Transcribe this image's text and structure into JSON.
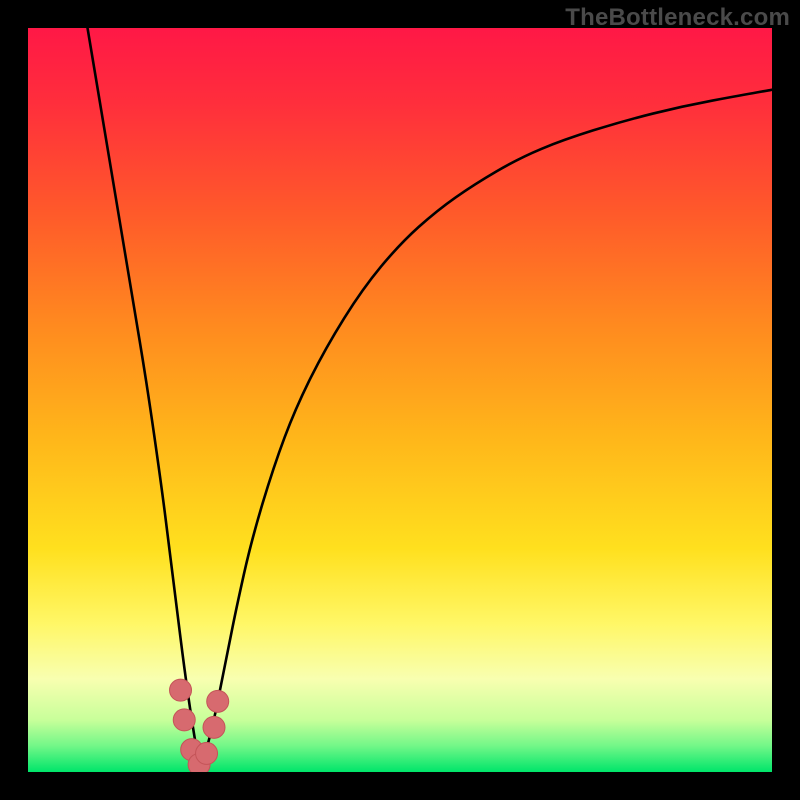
{
  "watermark": "TheBottleneck.com",
  "colors": {
    "frame": "#000000",
    "gradient_stops": [
      {
        "offset": 0.0,
        "color": "#ff1846"
      },
      {
        "offset": 0.1,
        "color": "#ff2e3c"
      },
      {
        "offset": 0.25,
        "color": "#ff5a2a"
      },
      {
        "offset": 0.4,
        "color": "#ff8a1f"
      },
      {
        "offset": 0.55,
        "color": "#ffb61a"
      },
      {
        "offset": 0.7,
        "color": "#ffe01e"
      },
      {
        "offset": 0.8,
        "color": "#fff766"
      },
      {
        "offset": 0.875,
        "color": "#f8ffb0"
      },
      {
        "offset": 0.93,
        "color": "#c8ff9a"
      },
      {
        "offset": 0.965,
        "color": "#72f788"
      },
      {
        "offset": 1.0,
        "color": "#00e56a"
      }
    ],
    "curve": "#000000",
    "marker_fill": "#d76a6f",
    "marker_stroke": "#c45458"
  },
  "chart_data": {
    "type": "line",
    "title": "",
    "xlabel": "",
    "ylabel": "",
    "xlim": [
      0,
      100
    ],
    "ylim": [
      0,
      100
    ],
    "x_min_at": 23,
    "series": [
      {
        "name": "bottleneck-curve",
        "x": [
          8,
          10,
          12,
          14,
          16,
          18,
          19,
          20,
          21,
          22,
          23,
          24,
          25,
          26,
          27,
          28,
          30,
          33,
          36,
          40,
          45,
          50,
          55,
          60,
          66,
          72,
          80,
          88,
          96,
          100
        ],
        "values": [
          100,
          88,
          76,
          64,
          52,
          38,
          30,
          22,
          14,
          7,
          1,
          3,
          7,
          12,
          17,
          22,
          31,
          41,
          49,
          57,
          65,
          71,
          75.5,
          79,
          82.5,
          85,
          87.5,
          89.5,
          91,
          91.7
        ]
      }
    ],
    "markers": {
      "name": "highlight-points",
      "x": [
        20.5,
        21.0,
        22.0,
        23.0,
        24.0,
        25.0,
        25.5
      ],
      "values": [
        11.0,
        7.0,
        3.0,
        1.0,
        2.5,
        6.0,
        9.5
      ]
    }
  }
}
